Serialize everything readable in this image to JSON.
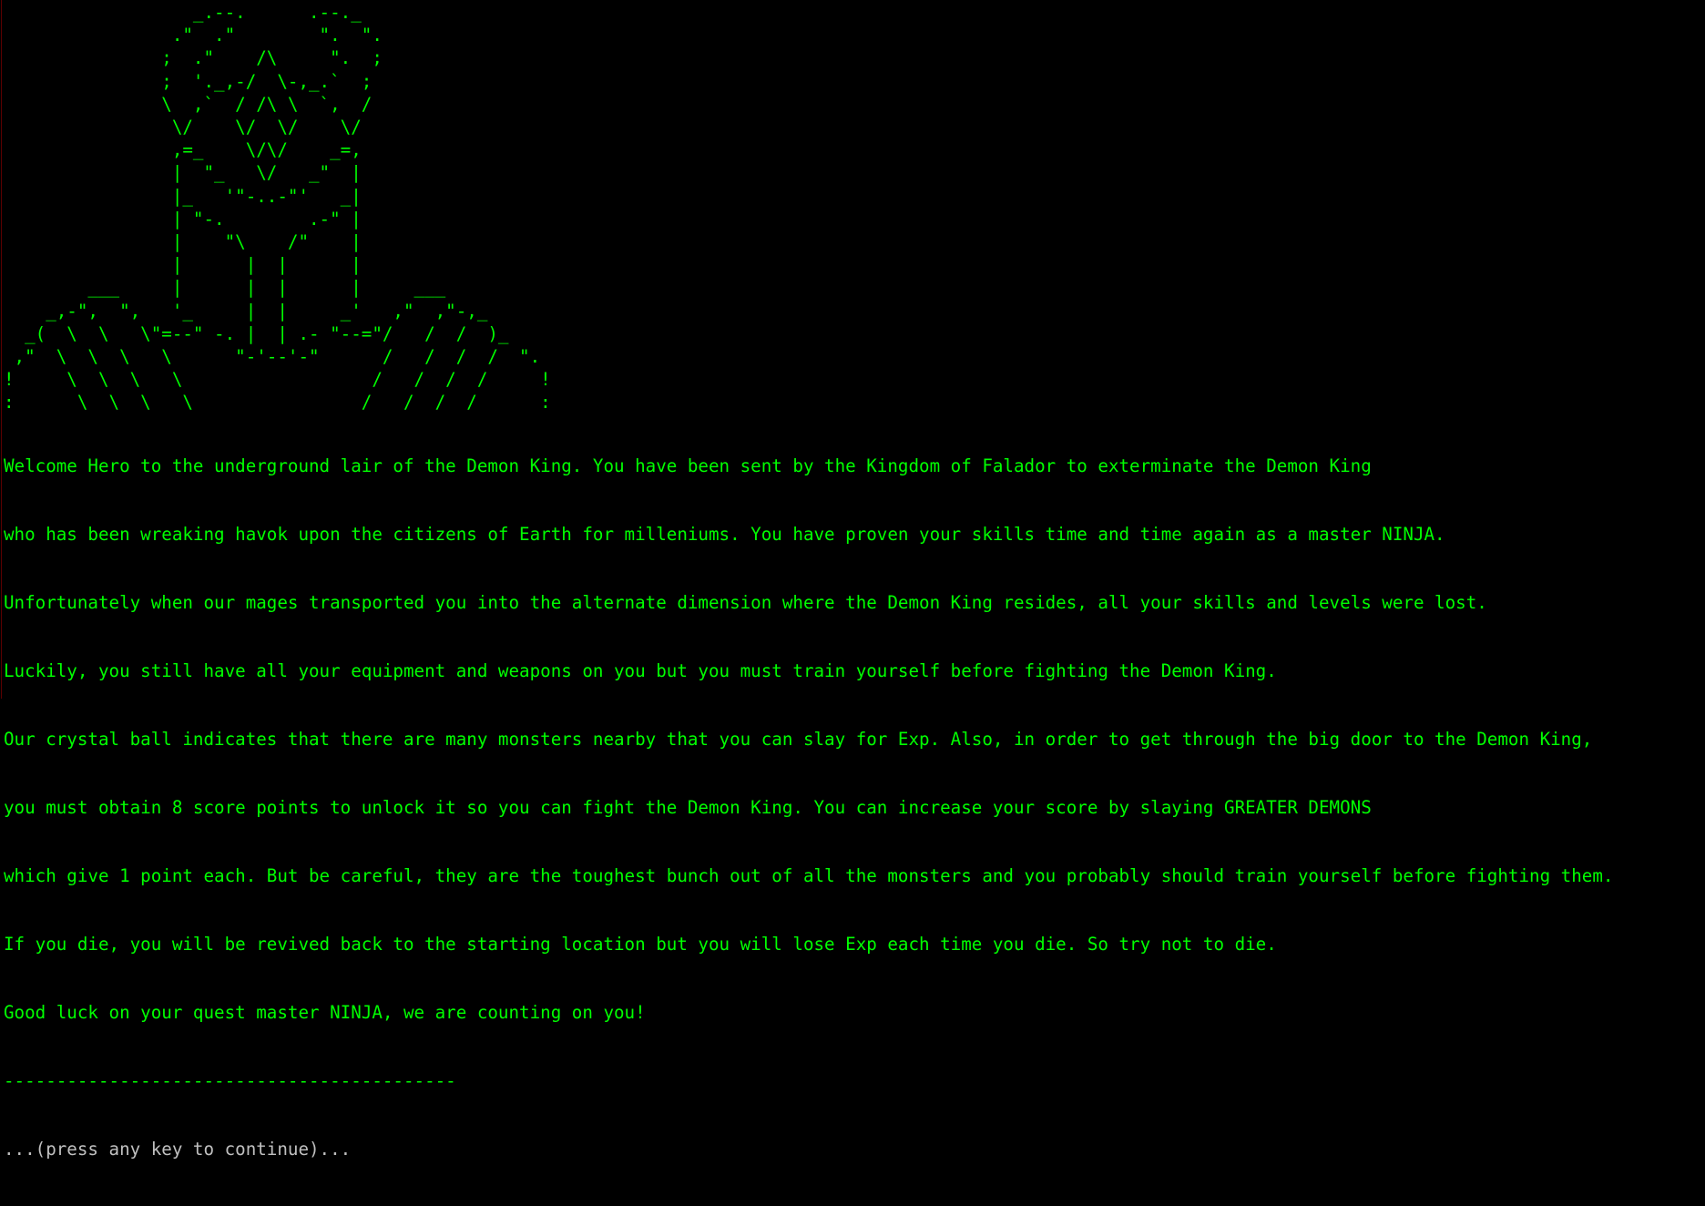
{
  "colors": {
    "background": "#000000",
    "text": "#00ff00",
    "prompt": "#c0c0c0"
  },
  "ascii_art": "                  _.--.      .--._\n                .\"  .\"        \".  \".\n               ;  .\"    /\\     \".  ;\n               ;  '._,-/  \\-,_.`  ;\n               \\  ,`  / /\\ \\  `,  /\n                \\/    \\/  \\/    \\/\n                ,=_    \\/\\/    _=,\n                |  \"_   \\/   _\"  |\n                |_   '\"-..-\"'   _|\n                | \"-.        .-\" |\n                |    \"\\    /\"    |\n                |      |  |      |\n        ___     |      |  |      |     ___\n    _,-\",  \",   '_     |  |     _'   ,\"  ,\"-,_\n  _(  \\  \\   \\\"=--\" -. |  | .- \"--=\"/   /  /  )_\n ,\"  \\  \\  \\   \\      \"-'--'-\"      /   /  /  /  \".\n!     \\  \\  \\   \\                  /   /  /  /     !\n:      \\  \\  \\   \\                /   /  /  /      :",
  "story": {
    "lines": [
      "Welcome Hero to the underground lair of the Demon King. You have been sent by the Kingdom of Falador to exterminate the Demon King",
      "who has been wreaking havok upon the citizens of Earth for milleniums. You have proven your skills time and time again as a master NINJA.",
      "Unfortunately when our mages transported you into the alternate dimension where the Demon King resides, all your skills and levels were lost.",
      "Luckily, you still have all your equipment and weapons on you but you must train yourself before fighting the Demon King.",
      "Our crystal ball indicates that there are many monsters nearby that you can slay for Exp. Also, in order to get through the big door to the Demon King,",
      "you must obtain 8 score points to unlock it so you can fight the Demon King. You can increase your score by slaying GREATER DEMONS",
      "which give 1 point each. But be careful, they are the toughest bunch out of all the monsters and you probably should train yourself before fighting them.",
      "If you die, you will be revived back to the starting location but you will lose Exp each time you die. So try not to die.",
      "Good luck on your quest master NINJA, we are counting on you!"
    ],
    "divider": "-------------------------------------------",
    "prompt": "...(press any key to continue)..."
  }
}
